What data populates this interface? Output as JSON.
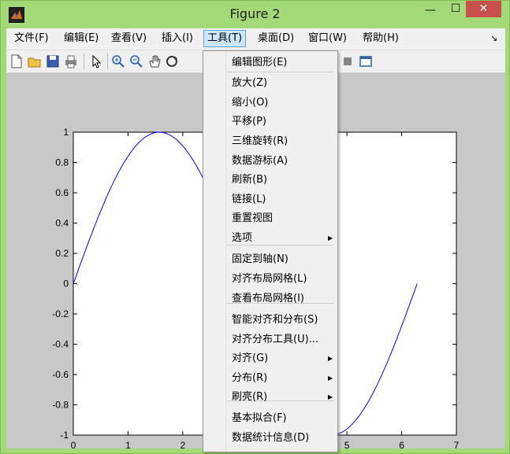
{
  "window": {
    "title": "Figure 2"
  },
  "menubar": [
    {
      "label": "文件(F)"
    },
    {
      "label": "编辑(E)"
    },
    {
      "label": "查看(V)"
    },
    {
      "label": "插入(I)"
    },
    {
      "label": "工具(T)"
    },
    {
      "label": "桌面(D)"
    },
    {
      "label": "窗口(W)"
    },
    {
      "label": "帮助(H)"
    }
  ],
  "toolbar": [
    "new-icon",
    "open-icon",
    "save-icon",
    "print-icon",
    "pointer-icon",
    "zoom-in-icon",
    "zoom-out-icon",
    "pan-icon",
    "rotate-icon",
    "legend-icon",
    "panel-icon"
  ],
  "tools_menu": {
    "items": [
      {
        "label": "编辑图形(E)"
      },
      {
        "label": "放大(Z)"
      },
      {
        "label": "缩小(O)"
      },
      {
        "label": "平移(P)"
      },
      {
        "label": "三维旋转(R)"
      },
      {
        "label": "数据游标(A)"
      },
      {
        "label": "刷新(B)"
      },
      {
        "label": "链接(L)"
      },
      {
        "label": "重置视图"
      },
      {
        "label": "选项",
        "submenu": true
      },
      {
        "label": "固定到轴(N)"
      },
      {
        "label": "对齐布局网格(L)"
      },
      {
        "label": "查看布局网格(I)"
      },
      {
        "label": "智能对齐和分布(S)"
      },
      {
        "label": "对齐分布工具(U)..."
      },
      {
        "label": "对齐(G)",
        "submenu": true
      },
      {
        "label": "分布(R)",
        "submenu": true
      },
      {
        "label": "刷亮(R)",
        "submenu": true
      },
      {
        "label": "基本拟合(F)"
      },
      {
        "label": "数据统计信息(D)"
      }
    ]
  },
  "chart_data": {
    "type": "line",
    "series": [
      {
        "function": "sin(x)",
        "x_range": [
          0,
          6.2832
        ],
        "color": "#0000ff"
      }
    ],
    "xlim": [
      0,
      7
    ],
    "ylim": [
      -1,
      1
    ],
    "xticks": [
      "0",
      "1",
      "2",
      "3",
      "4",
      "5",
      "6",
      "7"
    ],
    "yticks": [
      "1",
      "0.8",
      "0.6",
      "0.4",
      "0.2",
      "0",
      "-0.2",
      "-0.4",
      "-0.6",
      "-0.8",
      "-1"
    ],
    "grid": false
  }
}
